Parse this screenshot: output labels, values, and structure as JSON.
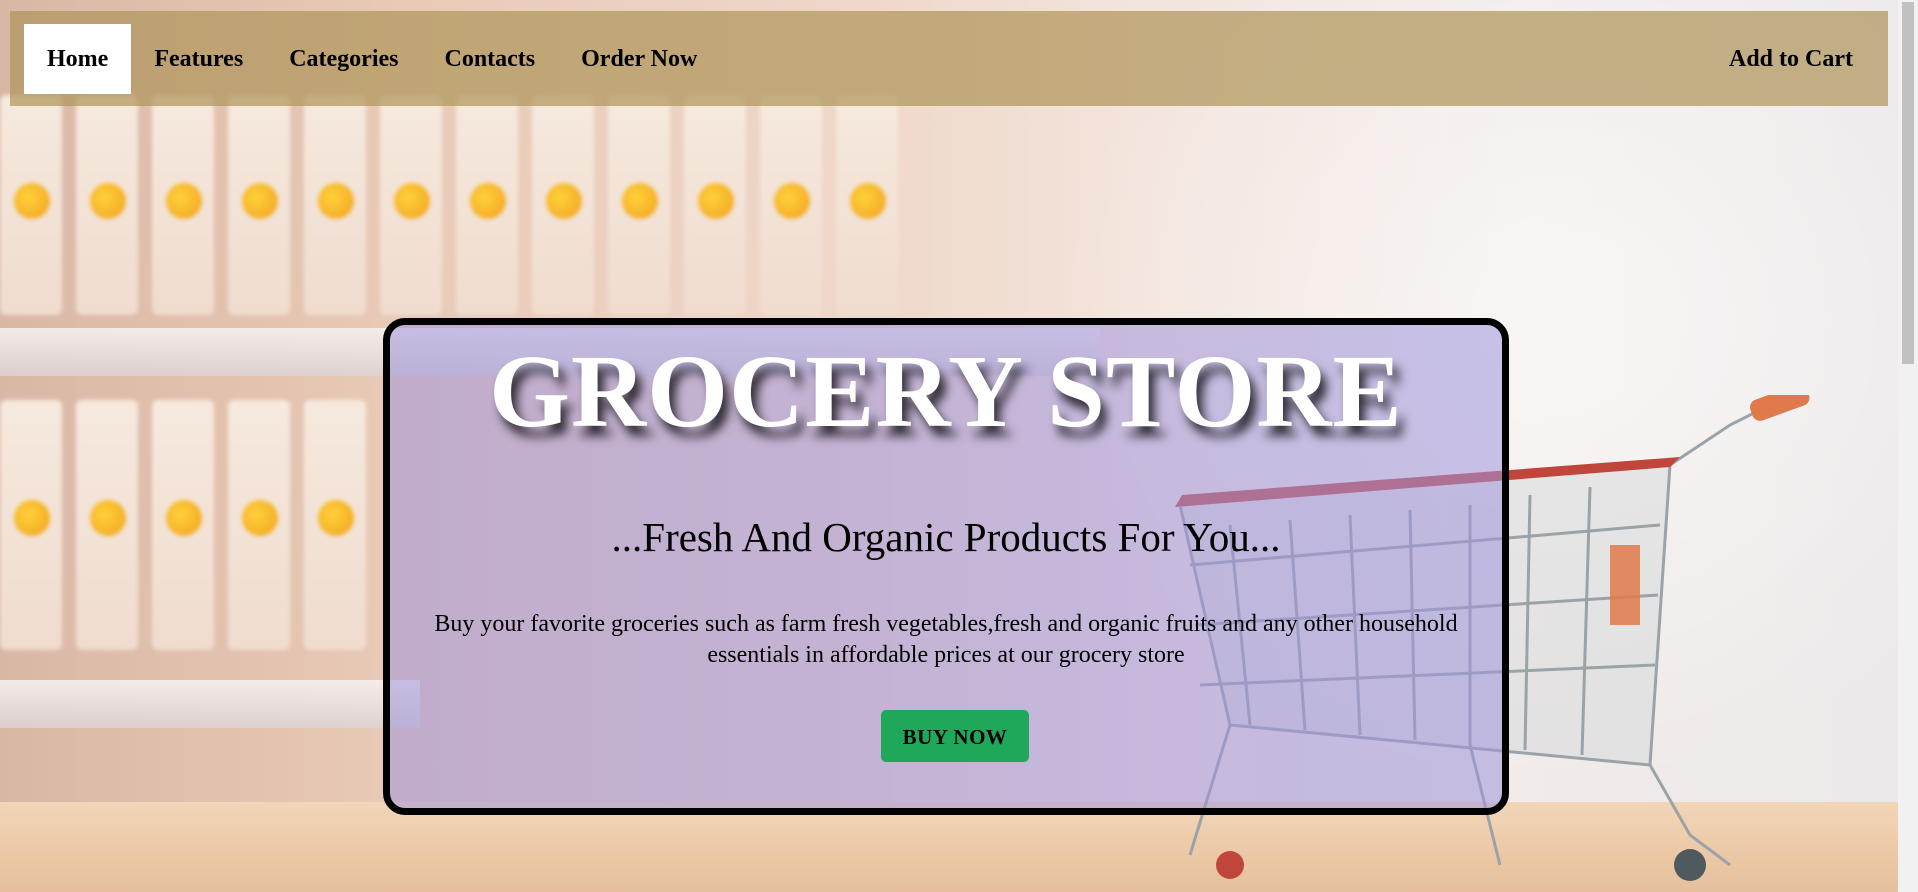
{
  "navbar": {
    "items": [
      {
        "label": "Home",
        "active": true
      },
      {
        "label": "Features",
        "active": false
      },
      {
        "label": "Categories",
        "active": false
      },
      {
        "label": "Contacts",
        "active": false
      },
      {
        "label": "Order Now",
        "active": false
      }
    ],
    "cart_label": "Add to Cart"
  },
  "hero": {
    "title": "GROCERY STORE",
    "subtitle": "...Fresh And Organic Products For You...",
    "description": "Buy your favorite groceries such as farm fresh vegetables,fresh and organic fruits and any other household essentials in affordable prices at our grocery store",
    "button_label": "BUY NOW"
  },
  "colors": {
    "navbar_bg": "#b0965c",
    "hero_bg": "#a096dc",
    "button_bg": "#1fa85a",
    "border": "#000000"
  },
  "background": {
    "icon": "shopping-cart-image"
  }
}
